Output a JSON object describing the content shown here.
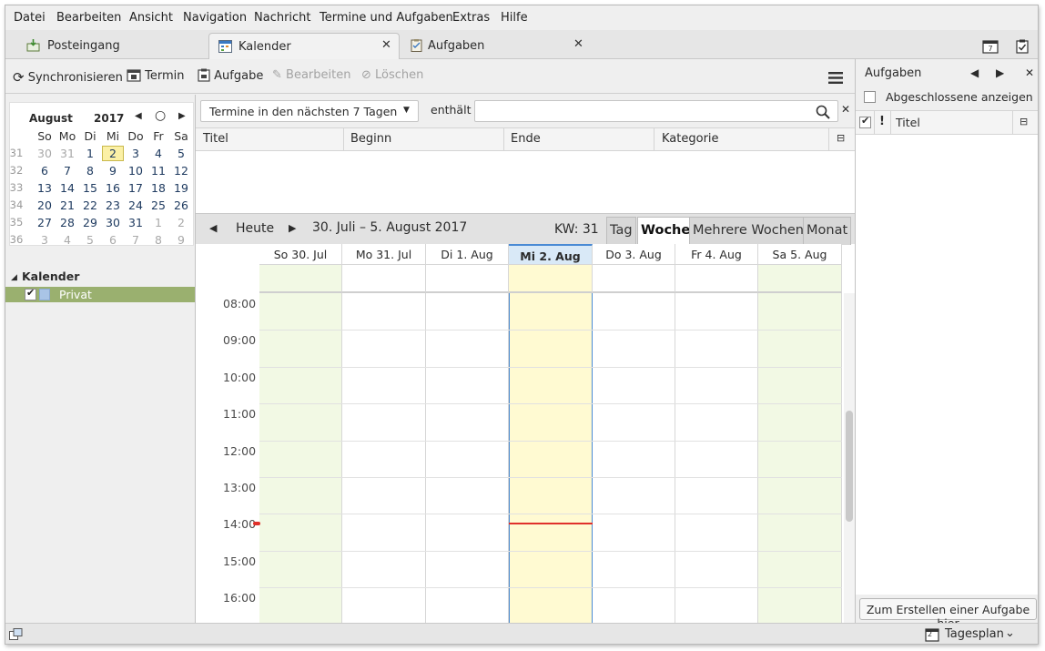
{
  "menubar": {
    "items": [
      {
        "label": "Datei"
      },
      {
        "label": "Bearbeiten"
      },
      {
        "label": "Ansicht"
      },
      {
        "label": "Navigation"
      },
      {
        "label": "Nachricht"
      },
      {
        "label": "Termine und Aufgaben"
      },
      {
        "label": "Extras"
      },
      {
        "label": "Hilfe"
      }
    ]
  },
  "tabs": [
    {
      "label": "Posteingang",
      "icon": "inbox-icon",
      "active": false
    },
    {
      "label": "Kalender",
      "icon": "calendar-icon",
      "active": true
    },
    {
      "label": "Aufgaben",
      "icon": "tasks-icon",
      "active": false
    }
  ],
  "toolbar": {
    "sync": "Synchronisieren",
    "event": "Termin",
    "task": "Aufgabe",
    "edit": "Bearbeiten",
    "delete": "Löschen"
  },
  "minical": {
    "month": "August",
    "year": "2017",
    "dow": [
      "So",
      "Mo",
      "Di",
      "Mi",
      "Do",
      "Fr",
      "Sa"
    ],
    "weeks": [
      {
        "wk": "31",
        "days": [
          {
            "d": "30",
            "o": 1
          },
          {
            "d": "31",
            "o": 1
          },
          {
            "d": "1"
          },
          {
            "d": "2",
            "t": 1
          },
          {
            "d": "3"
          },
          {
            "d": "4"
          },
          {
            "d": "5"
          }
        ]
      },
      {
        "wk": "32",
        "days": [
          {
            "d": "6"
          },
          {
            "d": "7"
          },
          {
            "d": "8"
          },
          {
            "d": "9"
          },
          {
            "d": "10"
          },
          {
            "d": "11"
          },
          {
            "d": "12"
          }
        ]
      },
      {
        "wk": "33",
        "days": [
          {
            "d": "13"
          },
          {
            "d": "14"
          },
          {
            "d": "15"
          },
          {
            "d": "16"
          },
          {
            "d": "17"
          },
          {
            "d": "18"
          },
          {
            "d": "19"
          }
        ]
      },
      {
        "wk": "34",
        "days": [
          {
            "d": "20"
          },
          {
            "d": "21"
          },
          {
            "d": "22"
          },
          {
            "d": "23"
          },
          {
            "d": "24"
          },
          {
            "d": "25"
          },
          {
            "d": "26"
          }
        ]
      },
      {
        "wk": "35",
        "days": [
          {
            "d": "27"
          },
          {
            "d": "28"
          },
          {
            "d": "29"
          },
          {
            "d": "30"
          },
          {
            "d": "31"
          },
          {
            "d": "1",
            "o": 1
          },
          {
            "d": "2",
            "o": 1
          }
        ]
      },
      {
        "wk": "36",
        "days": [
          {
            "d": "3",
            "o": 1
          },
          {
            "d": "4",
            "o": 1
          },
          {
            "d": "5",
            "o": 1
          },
          {
            "d": "6",
            "o": 1
          },
          {
            "d": "7",
            "o": 1
          },
          {
            "d": "8",
            "o": 1
          },
          {
            "d": "9",
            "o": 1
          }
        ]
      }
    ]
  },
  "calendars": {
    "heading": "Kalender",
    "items": [
      {
        "name": "Privat",
        "checked": true,
        "color": "#a9c4e6"
      }
    ]
  },
  "filter": {
    "selected": "Termine in den nächsten 7 Tagen",
    "contains_label": "enthält",
    "search_value": ""
  },
  "list_columns": [
    "Titel",
    "Beginn",
    "Ende",
    "Kategorie"
  ],
  "viewnav": {
    "today": "Heute",
    "range": "30. Juli – 5. August 2017",
    "week": "KW: 31",
    "views": [
      "Tag",
      "Woche",
      "Mehrere Wochen",
      "Monat"
    ],
    "active_view": "Woche"
  },
  "week": {
    "days": [
      {
        "label": "So 30. Jul",
        "weekend": true
      },
      {
        "label": "Mo 31. Jul"
      },
      {
        "label": "Di 1. Aug"
      },
      {
        "label": "Mi 2. Aug",
        "today": true
      },
      {
        "label": "Do 3. Aug"
      },
      {
        "label": "Fr 4. Aug"
      },
      {
        "label": "Sa 5. Aug",
        "weekend": true
      }
    ],
    "hours": [
      "08:00",
      "09:00",
      "10:00",
      "11:00",
      "12:00",
      "13:00",
      "14:00",
      "15:00",
      "16:00"
    ],
    "now_time": "14:00"
  },
  "tasks_pane": {
    "title": "Aufgaben",
    "show_completed": "Abgeschlossene anzeigen",
    "col_title": "Titel",
    "col_priority": "!",
    "create_hint": "Zum Erstellen einer Aufgabe hier"
  },
  "statusbar": {
    "today_pane": "Tagesplan",
    "today_icon_day": "2"
  },
  "colors": {
    "weekend_bg": "#f2f9e4",
    "today_bg": "#fffad2",
    "today_header": "#d9e9f7",
    "now_line": "#e0302a",
    "calendar_row": "#9ab06f"
  }
}
